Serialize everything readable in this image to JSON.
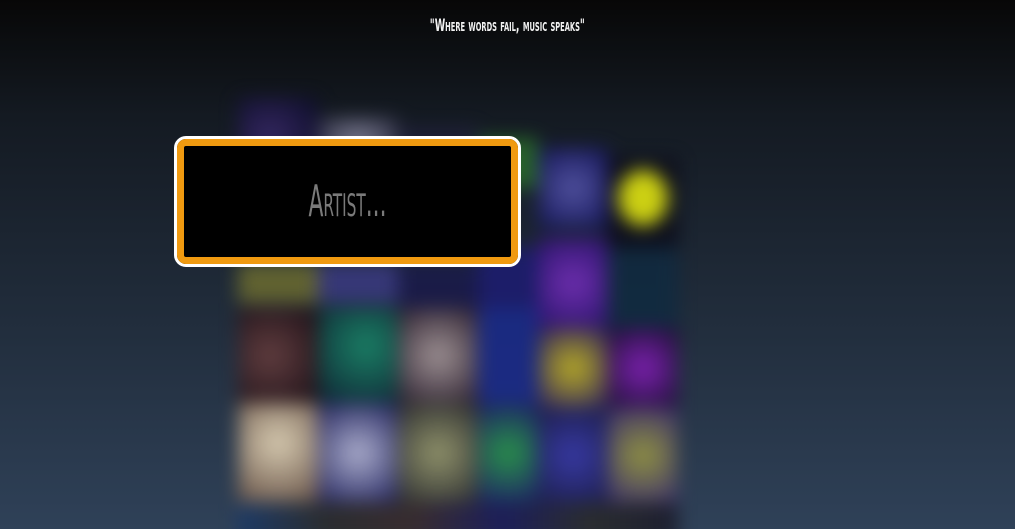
{
  "quote": "\"Where words fail, music speaks\"",
  "search": {
    "placeholder": "Artist...",
    "value": ""
  },
  "colors": {
    "accent": "#f09a10",
    "border": "#ffffff",
    "input_bg": "#000000",
    "placeholder": "#7a7a7a"
  },
  "background": {
    "description_tiles": [
      "album-art-mosaic"
    ]
  }
}
